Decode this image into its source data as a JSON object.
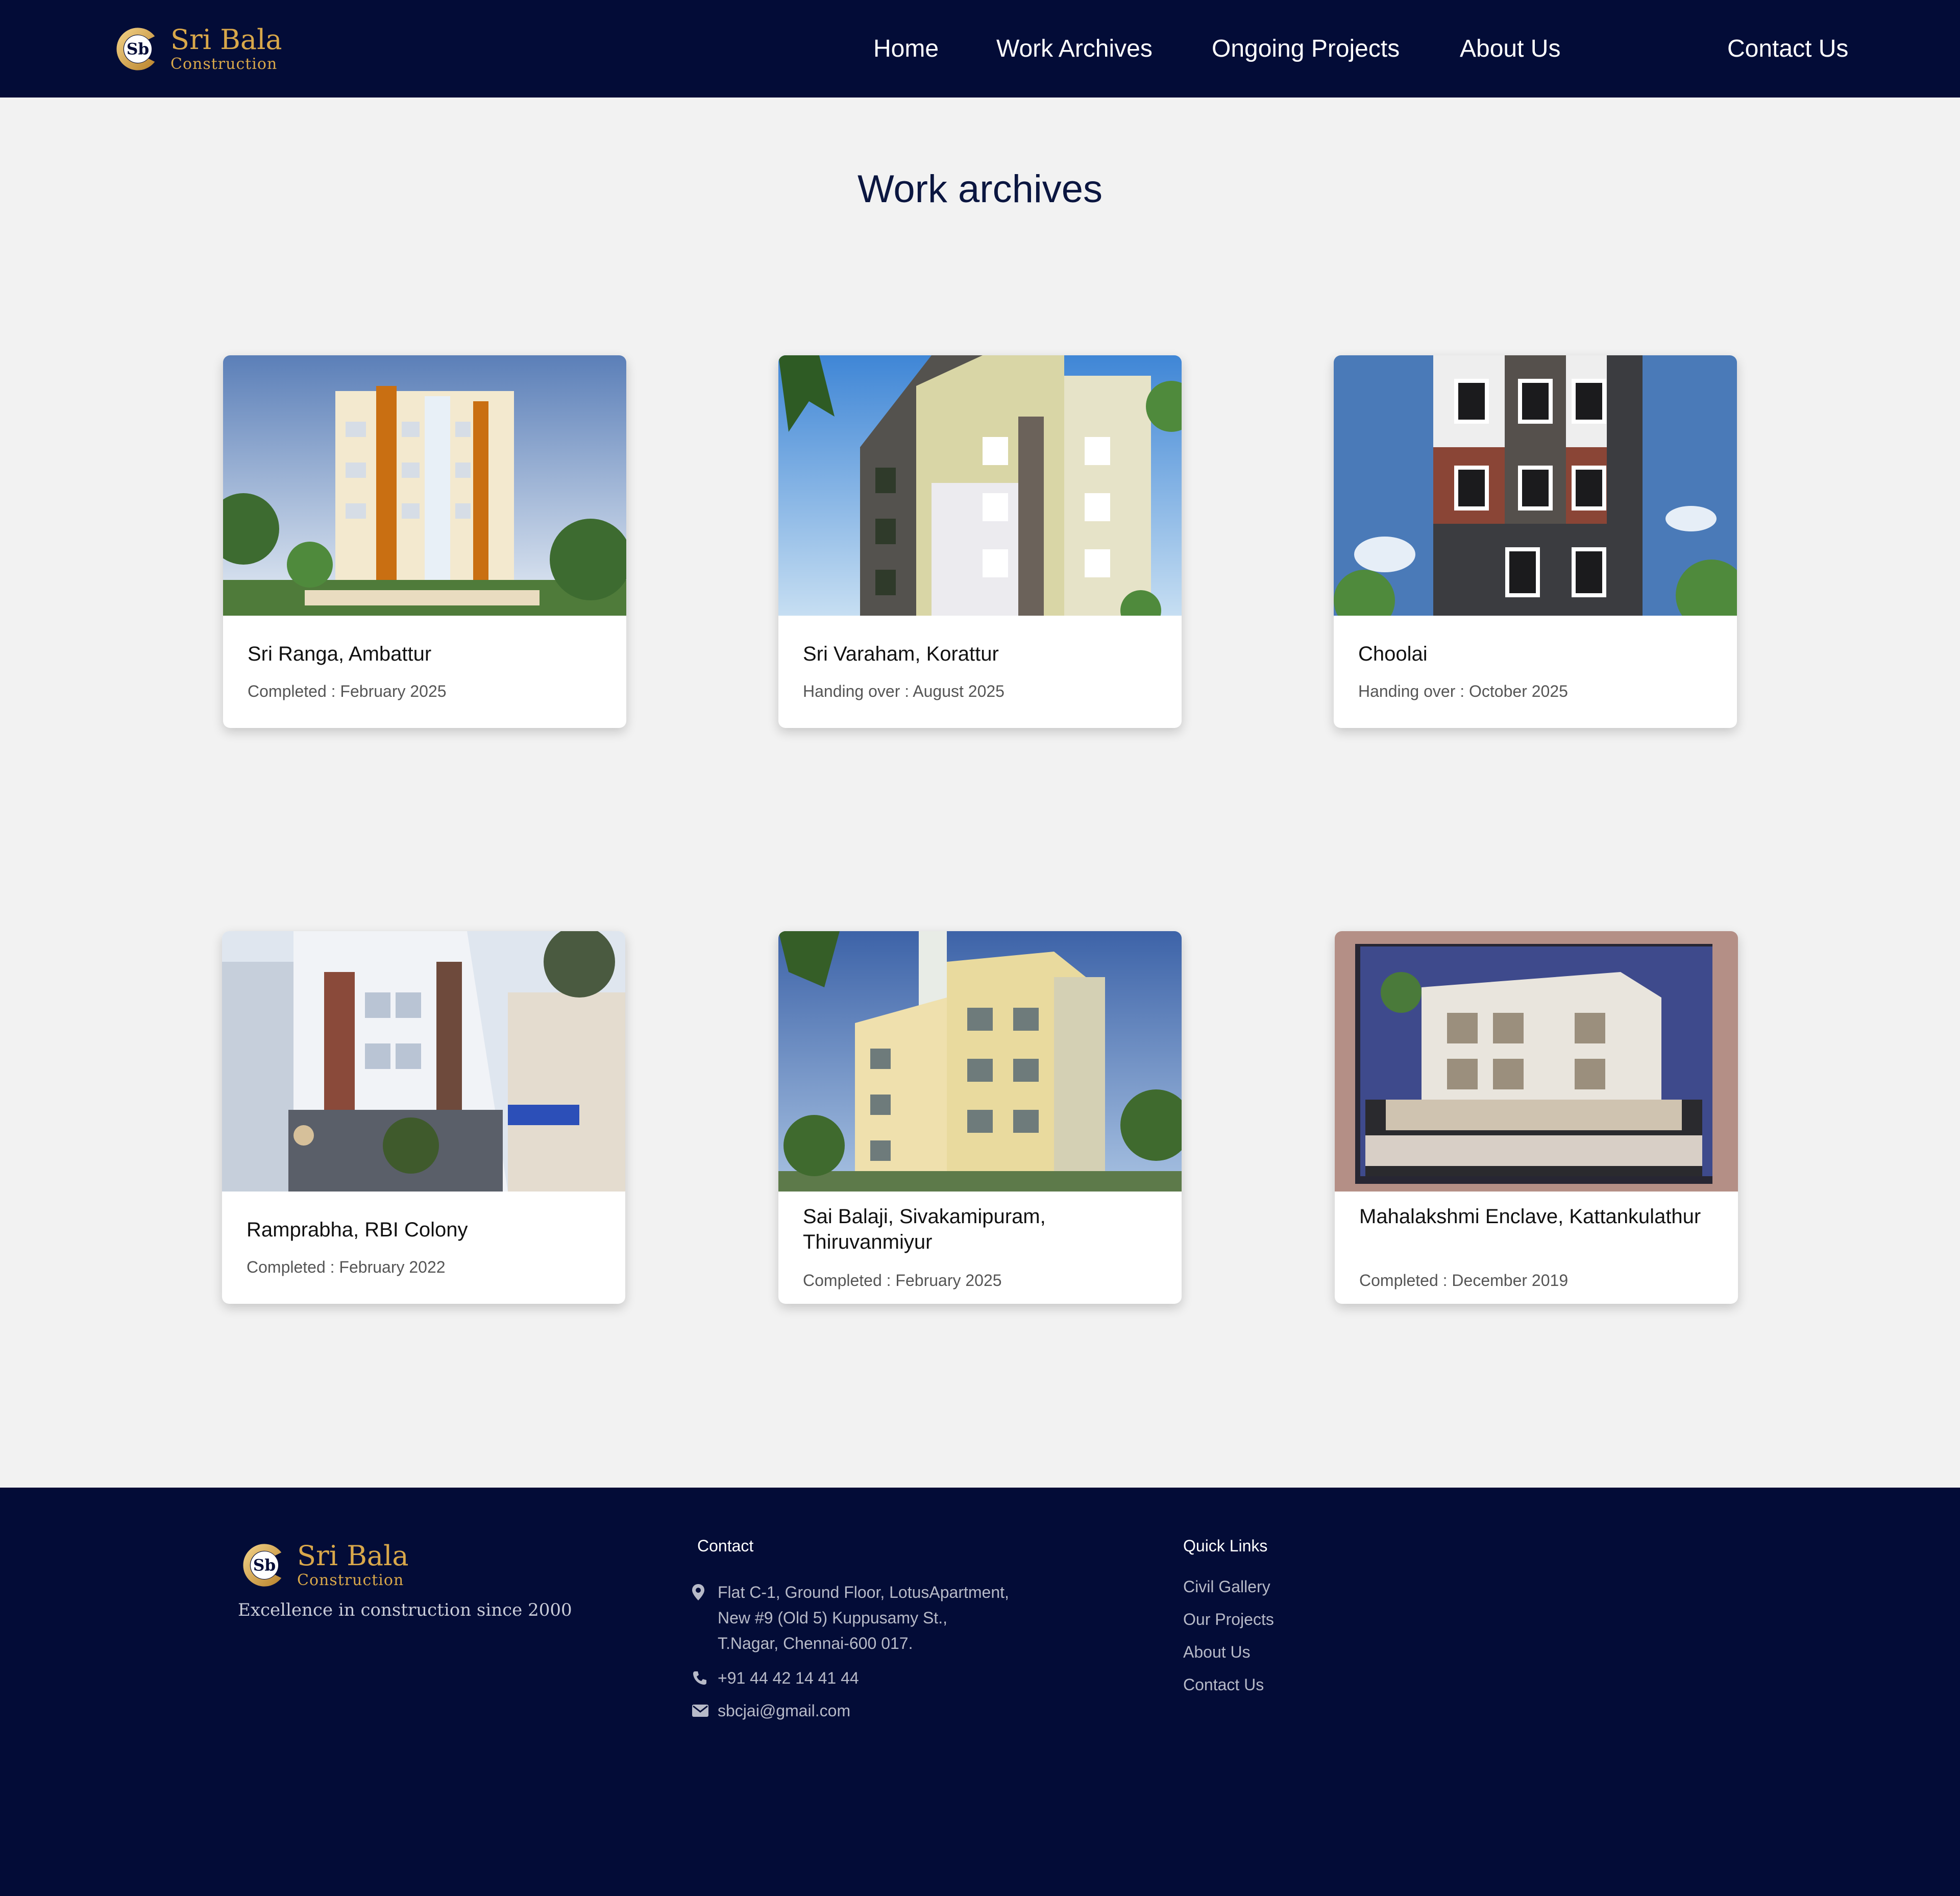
{
  "colors": {
    "navy": "#030c37",
    "gold": "#d9a84a",
    "page_bg": "#f2f2f2",
    "card_bg": "#ffffff"
  },
  "brand": {
    "monogram": "Sb",
    "name": "Sri Bala",
    "sub": "Construction",
    "logo_icon": "sb-monogram-logo-icon"
  },
  "nav": {
    "home": "Home",
    "work_archives": "Work Archives",
    "ongoing_projects": "Ongoing Projects",
    "about_us": "About Us",
    "contact_us": "Contact Us"
  },
  "page": {
    "title": "Work archives"
  },
  "projects": [
    {
      "title": "Sri Ranga, Ambattur",
      "status": "Completed : February 2025",
      "image": "apartment-building-photo"
    },
    {
      "title": "Sri Varaham, Korattur",
      "status": "Handing over : August 2025",
      "image": "apartment-building-photo"
    },
    {
      "title": "Choolai",
      "status": "Handing over : October 2025",
      "image": "apartment-building-photo"
    },
    {
      "title": "Ramprabha, RBI Colony",
      "status": "Completed : February 2022",
      "image": "apartment-building-photo"
    },
    {
      "title": "Sai Balaji, Sivakamipuram, Thiruvanmiyur",
      "status": "Completed : February 2025",
      "image": "apartment-building-photo"
    },
    {
      "title": "Mahalakshmi Enclave, Kattankulathur",
      "status": "Completed : December 2019",
      "image": "apartment-building-photo"
    }
  ],
  "footer": {
    "tagline": "Excellence in construction since 2000",
    "contact_heading": "Contact",
    "address_lines": [
      "Flat C-1, Ground Floor, LotusApartment,",
      "New #9 (Old 5) Kuppusamy St.,",
      "T.Nagar, Chennai-600 017."
    ],
    "phone": "+91 44 42 14 41 44",
    "email": "sbcjai@gmail.com",
    "quick_links_heading": "Quick Links",
    "quick_links": [
      "Civil Gallery",
      "Our Projects",
      "About Us",
      "Contact Us"
    ],
    "icons": {
      "address": "map-pin-icon",
      "phone": "phone-icon",
      "email": "envelope-icon"
    }
  }
}
